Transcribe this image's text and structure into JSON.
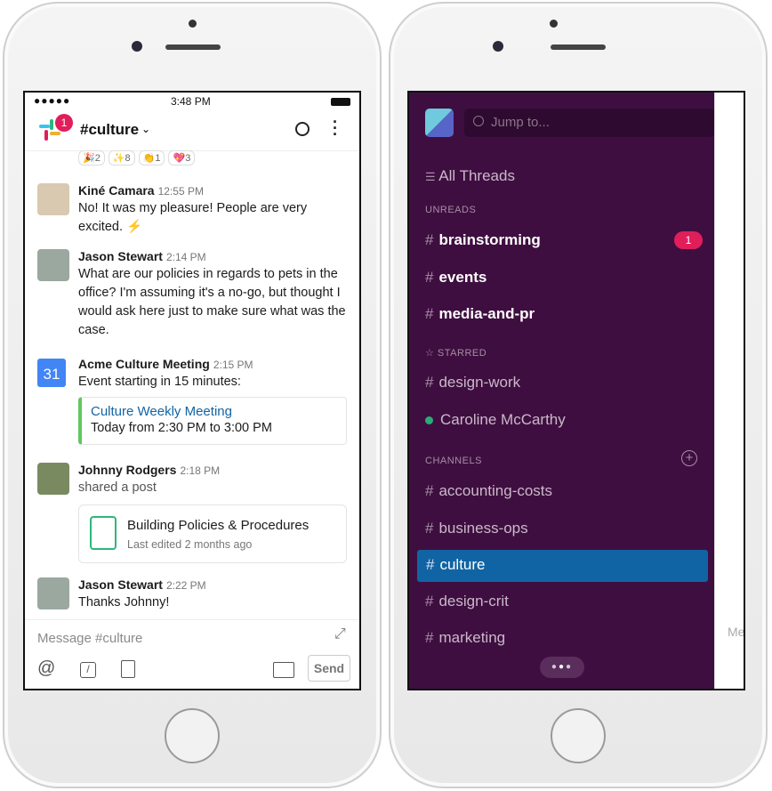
{
  "left": {
    "status": {
      "time": "3:48 PM"
    },
    "header": {
      "channel": "#culture",
      "badge": "1"
    },
    "reactions": [
      {
        "emoji": "🎉",
        "count": "2"
      },
      {
        "emoji": "✨",
        "count": "8"
      },
      {
        "emoji": "👏",
        "count": "1"
      },
      {
        "emoji": "💖",
        "count": "3"
      }
    ],
    "messages": [
      {
        "name": "Kiné Camara",
        "time": "12:55 PM",
        "text": "No! It was my pleasure! People are very excited. ⚡"
      },
      {
        "name": "Jason Stewart",
        "time": "2:14 PM",
        "text": "What are our policies in regards to pets in the office? I'm assuming it's a no-go, but thought I would ask here just to make sure what was the case."
      },
      {
        "name": "Acme Culture Meeting",
        "time": "2:15 PM",
        "text": "Event starting in 15 minutes:",
        "calendar_day": "31",
        "event_title": "Culture Weekly Meeting",
        "event_time": "Today from 2:30 PM to 3:00 PM"
      },
      {
        "name": "Johnny Rodgers",
        "time": "2:18 PM",
        "text": "shared a post",
        "post_title": "Building Policies & Procedures",
        "post_sub": "Last edited 2 months ago"
      },
      {
        "name": "Jason Stewart",
        "time": "2:22 PM",
        "text": "Thanks Johnny!"
      }
    ],
    "composer": {
      "placeholder": "Message #culture",
      "send": "Send"
    }
  },
  "right": {
    "search_placeholder": "Jump to...",
    "all_threads": "All Threads",
    "unreads_label": "UNREADS",
    "unreads": [
      {
        "name": "brainstorming",
        "badge": "1"
      },
      {
        "name": "events"
      },
      {
        "name": "media-and-pr"
      }
    ],
    "starred_label": "STARRED",
    "starred": [
      {
        "name": "design-work"
      },
      {
        "name": "Caroline McCarthy"
      }
    ],
    "channels_label": "CHANNELS",
    "channels": [
      {
        "name": "accounting-costs"
      },
      {
        "name": "business-ops"
      },
      {
        "name": "culture",
        "active": true
      },
      {
        "name": "design-crit"
      },
      {
        "name": "marketing"
      }
    ],
    "peek_placeholder": "Me"
  },
  "colors": {
    "sidebar": "#3f0e40",
    "active": "#1164a3",
    "badge": "#e01e5a",
    "link": "#1264a3",
    "presence": "#2bac76"
  }
}
